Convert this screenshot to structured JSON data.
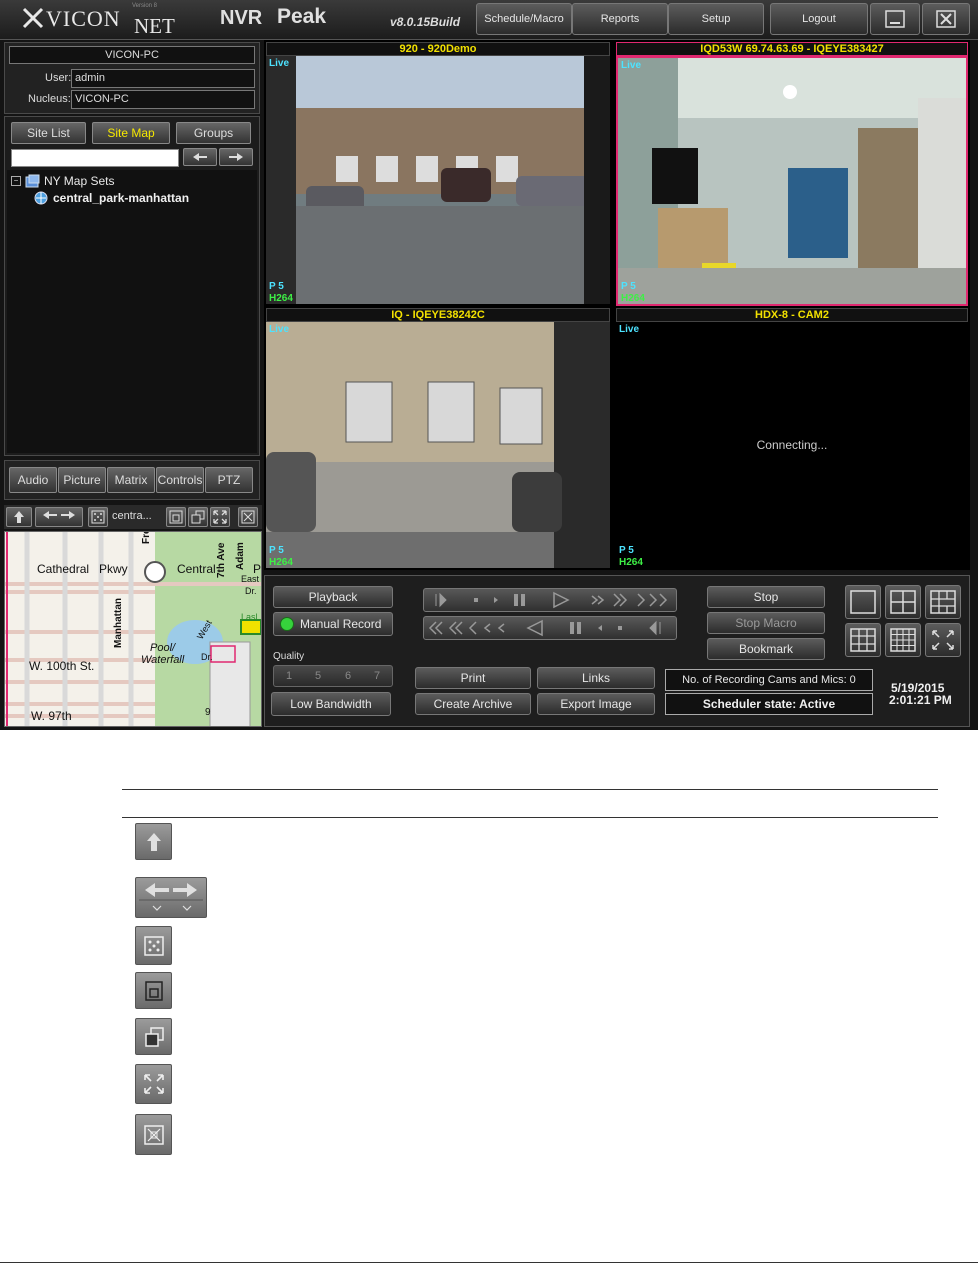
{
  "header": {
    "logo_text": "VICON",
    "logo_net": "NET",
    "logo_small": "Version 8",
    "product_nvr": "NVR",
    "product_peak": "Peak",
    "version": "v8.0.15Build",
    "menu": [
      "Schedule/Macro",
      "Reports",
      "Setup"
    ],
    "logout": "Logout"
  },
  "server": {
    "name": "VICON-PC",
    "user_label": "User:",
    "user_value": "admin",
    "nucleus_label": "Nucleus:",
    "nucleus_value": "VICON-PC"
  },
  "tabs": [
    "Site List",
    "Site Map",
    "Groups"
  ],
  "active_tab": "Site Map",
  "tree": {
    "root": "NY Map Sets",
    "child": "central_park-manhattan"
  },
  "bottom_tabs": [
    "Audio",
    "Picture",
    "Matrix",
    "Controls",
    "PTZ"
  ],
  "map_toolbar": {
    "map_name": "centra..."
  },
  "map": {
    "labels": [
      "Cathedral",
      "Pkwy",
      "Central",
      "Fred.",
      "7th Ave",
      "Adam",
      "East",
      "Dr.",
      "Manhattan",
      "Pool/",
      "Waterfall",
      "West",
      "Dr.",
      "W. 100th St.",
      "W. 97th",
      "9",
      "P",
      "Lasl"
    ]
  },
  "cameras": [
    {
      "title": "920  -  920Demo",
      "live": "Live",
      "p": "P  5",
      "codec": "H264"
    },
    {
      "title": "IQD53W 69.74.63.69  -  IQEYE383427",
      "live": "Live",
      "p": "P  5",
      "codec": "H264"
    },
    {
      "title": "IQ  -  IQEYE38242C",
      "live": "Live",
      "p": "P  5",
      "codec": "H264"
    },
    {
      "title": "HDX-8  -  CAM2",
      "live": "Live",
      "p": "P  5",
      "codec": "H264",
      "status": "Connecting..."
    }
  ],
  "controls": {
    "playback": "Playback",
    "manual_record": "Manual Record",
    "quality_label": "Quality",
    "quality_options": [
      "1",
      "5",
      "6",
      "7"
    ],
    "low_bandwidth": "Low Bandwidth",
    "print": "Print",
    "links": "Links",
    "create_archive": "Create Archive",
    "export_image": "Export Image",
    "stop": "Stop",
    "stop_macro": "Stop Macro",
    "bookmark": "Bookmark",
    "recording_cams": "No. of Recording Cams and Mics: 0",
    "scheduler_state": "Scheduler state: Active",
    "date": "5/19/2015",
    "time": "2:01:21 PM"
  },
  "legend_icons": [
    "up-arrow-icon",
    "pan-arrows-icon",
    "grid-dots-icon",
    "small-window-icon",
    "overlap-window-icon",
    "expand-arrows-icon",
    "cross-grid-icon"
  ],
  "colors": {
    "camera_title": "#f3e100",
    "live_text": "#4de3ff",
    "codec_text": "#3ef046",
    "selected_border": "#e02870",
    "active_tab": "#f5e800",
    "record_led": "#36d23c"
  }
}
